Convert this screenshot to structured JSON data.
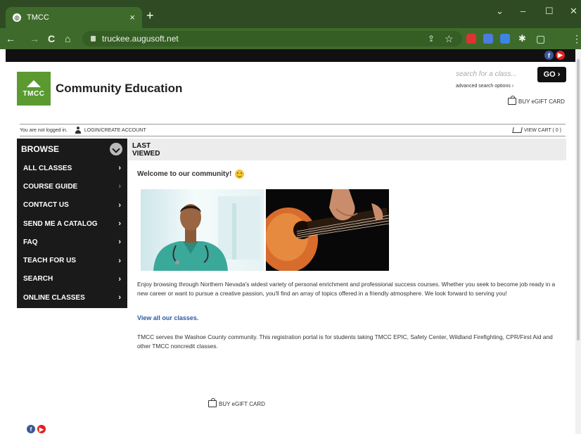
{
  "browser": {
    "tab_title": "TMCC",
    "tab_close": "×",
    "new_tab": "+",
    "url": "truckee.augusoft.net",
    "window_controls": {
      "menu": "⌄",
      "minimize": "–",
      "restore": "☐",
      "close": "✕"
    },
    "nav": {
      "back": "←",
      "forward": "→",
      "reload": "C",
      "home": "⌂",
      "share": "⇪",
      "star": "☆",
      "puzzle": "✱",
      "sidebar": "▢",
      "more": "⋮"
    }
  },
  "header": {
    "logo_text": "TMCC",
    "title": "Community Education",
    "search_placeholder": "search for a class...",
    "go_label": "GO ›",
    "advanced_search": "advanced search options ›",
    "gift_card": "BUY eGIFT CARD"
  },
  "userbar": {
    "status": "You are not logged in.",
    "login": "LOGIN/CREATE ACCOUNT",
    "cart": "VIEW CART ( 0 )"
  },
  "sidebar": {
    "title": "BROWSE",
    "items": [
      {
        "label": "ALL CLASSES",
        "chev": "›"
      },
      {
        "label": "COURSE GUIDE",
        "chev": "›"
      },
      {
        "label": "CONTACT US",
        "chev": "›"
      },
      {
        "label": "SEND ME A CATALOG",
        "chev": "›"
      },
      {
        "label": "FAQ",
        "chev": "›"
      },
      {
        "label": "TEACH FOR US",
        "chev": "›"
      },
      {
        "label": "SEARCH",
        "chev": "›"
      },
      {
        "label": "ONLINE CLASSES",
        "chev": "›"
      }
    ]
  },
  "content": {
    "last_viewed_line1": "LAST",
    "last_viewed_line2": "VIEWED",
    "welcome": "Welcome to our community!",
    "intro": "Enjoy browsing through Northern Nevada's widest variety of personal enrichment and professional success courses. Whether you seek to become job ready in a new career or want to pursue a creative passion, you'll find an array of topics offered in a friendly atmosphere. We look forward to serving you!",
    "view_all": "View all our classes.",
    "notice": "TMCC serves the Washoe County community. This registration portal is for students taking TMCC EPIC, Safety Center, Wildland Firefighting, CPR/First Aid and other TMCC noncredit classes.",
    "gift_card_bottom": "BUY eGIFT CARD"
  },
  "social": {
    "facebook": "f",
    "youtube": "▶"
  },
  "colors": {
    "chrome_dark": "#2f4b23",
    "chrome": "#3e6b2b",
    "brand_green": "#5b9a30",
    "link": "#2c5aa0",
    "facebook": "#3b5998",
    "youtube": "#e02020"
  }
}
